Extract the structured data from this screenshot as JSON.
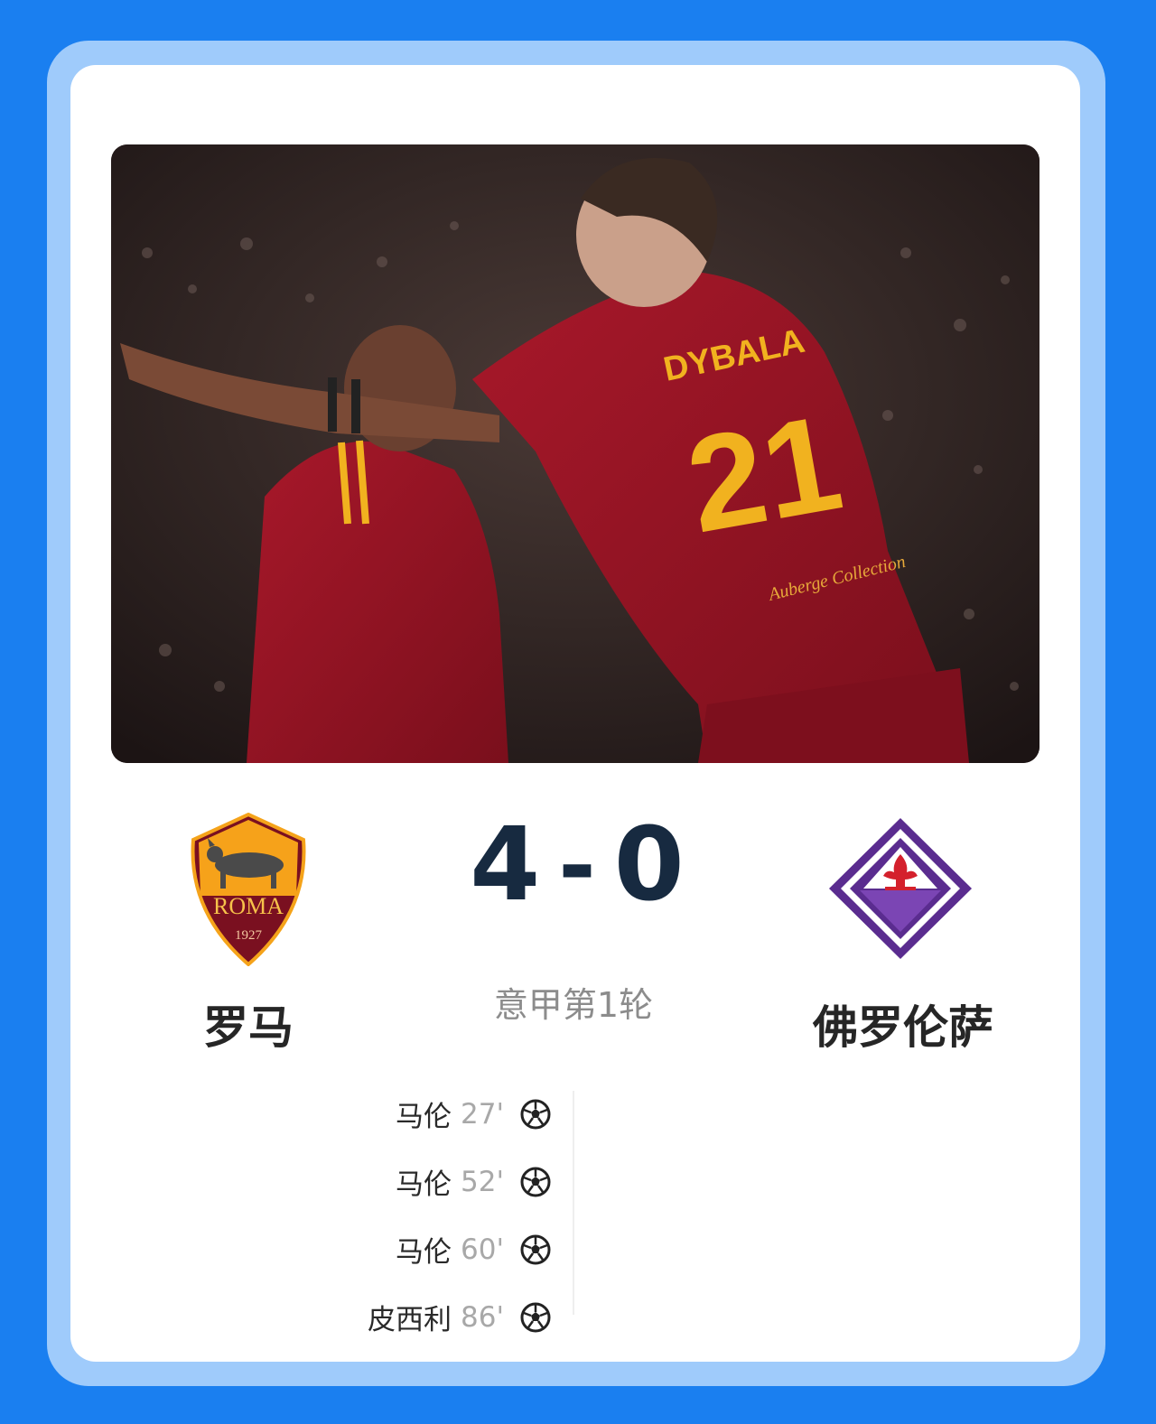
{
  "match": {
    "home_team": "罗马",
    "away_team": "佛罗伦萨",
    "home_score": "4",
    "separator": "-",
    "away_score": "0",
    "round": "意甲第1轮"
  },
  "crests": {
    "home": {
      "text": "ROMA",
      "year": "1927"
    }
  },
  "photo": {
    "jersey_name": "DYBALA",
    "jersey_number": "21",
    "sponsor": "Auberge Collection"
  },
  "goals": [
    {
      "player": "马伦",
      "minute": "27'",
      "icon": "soccer-ball-icon"
    },
    {
      "player": "马伦",
      "minute": "52'",
      "icon": "soccer-ball-icon"
    },
    {
      "player": "马伦",
      "minute": "60'",
      "icon": "soccer-ball-icon"
    },
    {
      "player": "皮西利",
      "minute": "86'",
      "icon": "soccer-ball-icon"
    }
  ],
  "colors": {
    "background": "#1a7ff0",
    "frame": "#9fcbfb",
    "score": "#172a40",
    "roma_red": "#8a1022",
    "roma_gold": "#f6a21a",
    "fiorentina_purple": "#5a2c8f"
  }
}
